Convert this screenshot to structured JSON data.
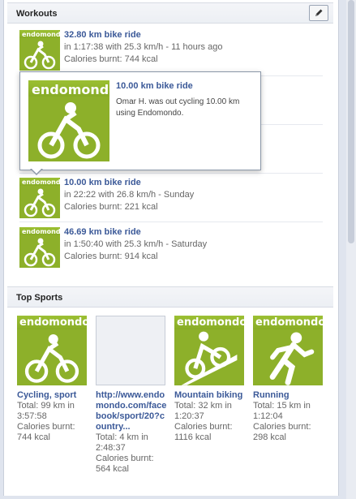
{
  "workouts": {
    "title": "Workouts",
    "edit_icon": "pencil-icon",
    "brand": "endomondo",
    "items": [
      {
        "title": "32.80 km bike ride",
        "line1": "in 1:17:38 with 25.3 km/h - 11 hours ago",
        "line2": "Calories burnt: 744 kcal"
      },
      {
        "title": "10.00 km bike ride",
        "line1": "in 22:22 with 26.8 km/h - Sunday",
        "line2": "Calories burnt: 221 kcal"
      },
      {
        "title": "46.69 km bike ride",
        "line1": "in 1:50:40 with 25.3 km/h - Saturday",
        "line2": "Calories burnt: 914 kcal"
      }
    ],
    "popup": {
      "title": "10.00 km bike ride",
      "description": "Omar H. was out cycling 10.00 km using Endomondo."
    }
  },
  "top_sports": {
    "title": "Top Sports",
    "items": [
      {
        "name": "Cycling, sport",
        "total": "Total: 99 km in 3:57:58",
        "calories": "Calories burnt: 744 kcal",
        "icon": "cycling-icon"
      },
      {
        "name": "http://www.endomondo.com/facebook/sport/20?country...",
        "total": "Total: 4 km in 2:48:37",
        "calories": "Calories burnt: 564 kcal",
        "icon": "image-placeholder"
      },
      {
        "name": "Mountain biking",
        "total": "Total: 32 km in 1:20:37",
        "calories": "Calories burnt: 1116 kcal",
        "icon": "mountain-biking-icon"
      },
      {
        "name": "Running",
        "total": "Total: 15 km in 1:12:04",
        "calories": "Calories burnt: 298 kcal",
        "icon": "running-icon"
      }
    ]
  },
  "colors": {
    "brand_green": "#8db02a",
    "link": "#3b5998"
  }
}
